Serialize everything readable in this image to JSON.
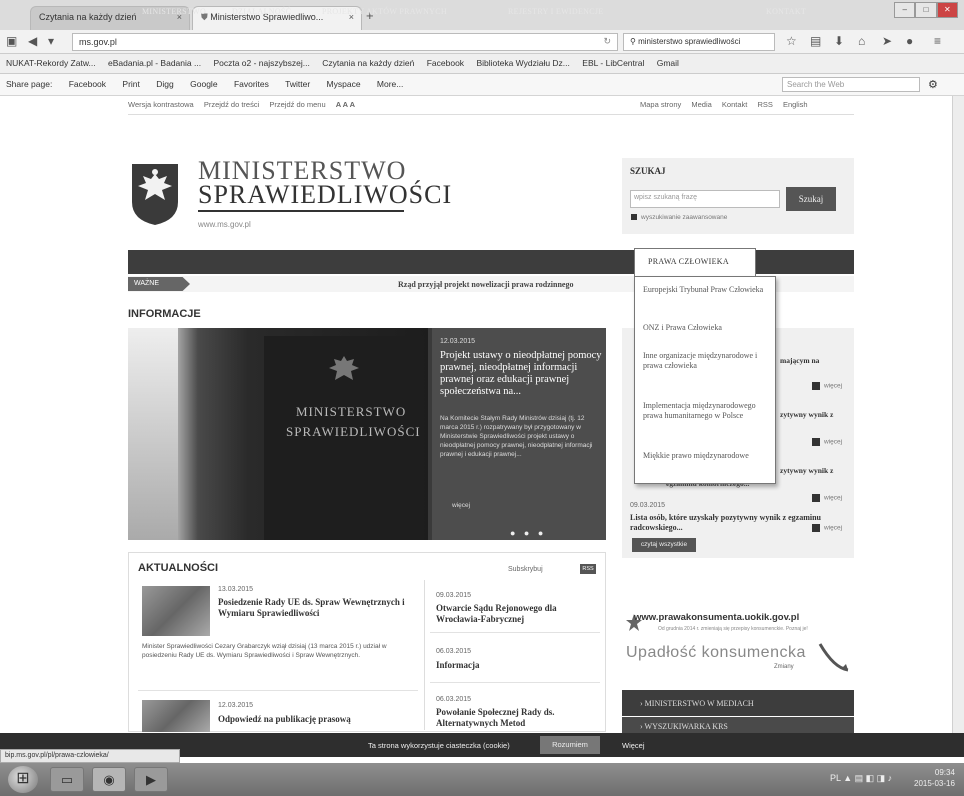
{
  "browser": {
    "tabs": [
      {
        "label": "Czytania na każdy dzień"
      },
      {
        "label": "Ministerstwo Sprawiedliwo..."
      }
    ],
    "new_tab": "+",
    "url": "ms.gov.pl",
    "search_value": "ministerstwo sprawiedliwości",
    "bookmarks": [
      "NUKAT-Rekordy Zatw...",
      "eBadania.pl - Badania ...",
      "Poczta o2 - najszybszej...",
      "Czytania na każdy dzień",
      "Facebook",
      "Biblioteka Wydziału Dz...",
      "EBL - LibCentral",
      "Gmail"
    ],
    "sharebar": {
      "label": "Share page:",
      "items": [
        "Facebook",
        "Print",
        "Digg",
        "Google",
        "Favorites",
        "Twitter",
        "Myspace",
        "More..."
      ],
      "search_placeholder": "Search the Web"
    },
    "status_url": "bip.ms.gov.pl/pl/prawa-czlowieka/"
  },
  "site": {
    "toplinks_left": [
      "Wersja kontrastowa",
      "Przejdź do treści",
      "Przejdź do menu",
      "A A A"
    ],
    "toplinks_right": [
      "Mapa strony",
      "Media",
      "Kontakt",
      "RSS",
      "English"
    ],
    "logo_line1": "MINISTERSTWO",
    "logo_line2": "SPRAWIEDLIWOŚCI",
    "logo_url": "www.ms.gov.pl",
    "search": {
      "title": "SZUKAJ",
      "placeholder": "wpisz szukaną frazę",
      "button": "Szukaj",
      "advanced": "wyszukiwanie zaawansowane"
    },
    "nav": [
      "MINISTERSTWO",
      "DZIAŁALNOŚĆ",
      "PROJEKTY AKTÓW PRAWNYCH",
      "REJESTRY I EWIDENCJE",
      "PRAWA CZŁOWIEKA",
      "KONTAKT"
    ],
    "ticker": {
      "tag": "WAŻNE",
      "text": "Rząd przyjął projekt nowelizacji prawa rodzinnego"
    },
    "dropdown": [
      "Europejski Trybunał Praw Człowieka",
      "ONZ i Prawa Człowieka",
      "Inne organizacje międzynarodowe i prawa człowieka",
      "Implementacja międzynarodowego prawa humanitarnego w Polsce",
      "Miękkie prawo międzynarodowe"
    ],
    "info": {
      "title": "INFORMACJE",
      "hero_plaque_1": "MINISTERSTWO",
      "hero_plaque_2": "SPRAWIEDLIWOŚCI",
      "hero_date": "12.03.2015",
      "hero_headline": "Projekt ustawy o nieodpłatnej pomocy prawnej, nieodpłatnej informacji prawnej oraz edukacji prawnej społeczeństwa na...",
      "hero_body": "Na Komitecie Stałym Rady Ministrów dzisiaj (tj. 12 marca 2015 r.) rozpatrywany był przygotowany w Ministerstwie Sprawiedliwości projekt ustawy o nieodpłatnej pomocy prawnej, nieodpłatnej informacji prawnej i edukacji prawnej...",
      "hero_more": "więcej",
      "hero_dots": "● ● ●"
    },
    "right_column": {
      "frag1": "mającym na",
      "frag2": "zytywny wynik z",
      "frag3": "zytywny wynik z",
      "frag3b": "egzaminu komorniczego...",
      "more": "więcej",
      "item_date": "09.03.2015",
      "item_text": "Lista osób, które uzyskały pozytywny wynik z egzaminu radcowskiego...",
      "all_button": "czytaj wszystkie"
    },
    "aktualnosci": {
      "title": "AKTUALNOŚCI",
      "subscribe": "Subskrybuj",
      "rss": "RSS",
      "left": [
        {
          "date": "13.03.2015",
          "title": "Posiedzenie Rady UE ds. Spraw Wewnętrznych i Wymiaru Sprawiedliwości",
          "body": "Minister Sprawiedliwości Cezary Grabarczyk wziął dzisiaj (13 marca 2015 r.) udział w posiedzeniu Rady UE ds. Wymiaru Sprawiedliwości i Spraw Wewnętrznych."
        },
        {
          "date": "12.03.2015",
          "title": "Odpowiedź na publikację prasową"
        }
      ],
      "right": [
        {
          "date": "09.03.2015",
          "title": "Otwarcie Sądu Rejonowego dla Wrocławia-Fabrycznej"
        },
        {
          "date": "06.03.2015",
          "title": "Informacja"
        },
        {
          "date": "06.03.2015",
          "title": "Powołanie Społecznej Rady ds. Alternatywnych Metod"
        }
      ]
    },
    "promo": {
      "uokik": "www.prawakonsumenta.uokik.gov.pl",
      "uokik_sub": "Od grudnia 2014 r. zmieniają się przepisy konsumenckie. Poznaj je!",
      "upadlosc": "Upadłość konsumencka",
      "upadlosc_sub": "Zmiany"
    },
    "bottom_nav": [
      "MINISTERSTWO W MEDIACH",
      "WYSZUKIWARKA KRS"
    ],
    "cookie": {
      "text": "Ta strona wykorzystuje ciasteczka (cookie)",
      "button": "Rozumiem",
      "more": "Więcej"
    }
  },
  "taskbar": {
    "tray": "PL",
    "time": "09:34",
    "date": "2015-03-16"
  }
}
